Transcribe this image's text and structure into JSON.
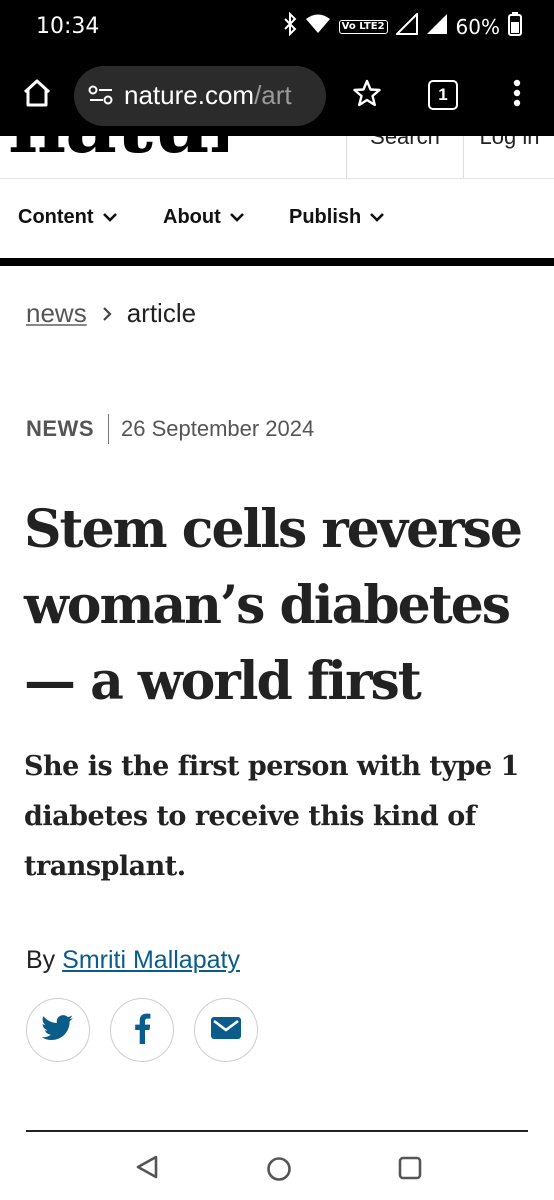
{
  "status_bar": {
    "time": "10:34",
    "volte": "Vo LTE2",
    "battery": "60%"
  },
  "browser": {
    "url_host": "nature.com",
    "url_path": "/art",
    "tab_count": "1"
  },
  "site": {
    "logo": "nature",
    "search": "Search",
    "login": "Log in",
    "nav": [
      {
        "label": "Content"
      },
      {
        "label": "About"
      },
      {
        "label": "Publish"
      }
    ]
  },
  "breadcrumb": {
    "parent": "news",
    "current": "article"
  },
  "article": {
    "type": "NEWS",
    "date": "26 September 2024",
    "title_lines": [
      "Stem cells reverse",
      "woman’s diabetes",
      "— a world first"
    ],
    "standfirst_lines": [
      "She is the first person with type 1",
      "diabetes to receive this kind of",
      "transplant."
    ],
    "by": "By",
    "author": "Smriti Mallapaty"
  },
  "colors": {
    "accent_link": "#0a5c8a",
    "chrome_dark": "#000000"
  }
}
